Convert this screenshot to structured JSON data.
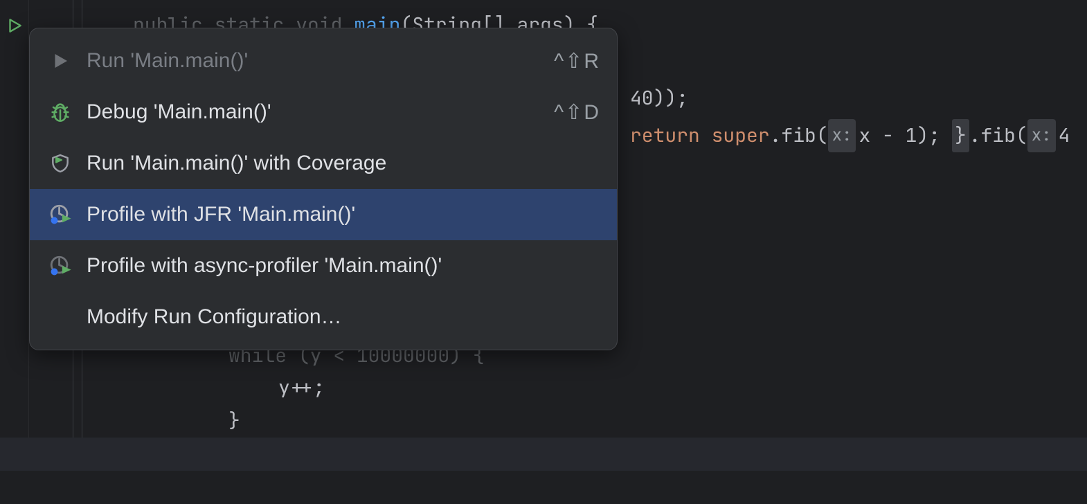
{
  "code": {
    "line1_prefix": "public static void ",
    "line1_method": "main",
    "line1_params": "(String[] args) {",
    "line2_suffix": "40));",
    "line3_kw_return": "return ",
    "line3_kw_super": "super",
    "line3_a": ".fib(",
    "line3_hint1": "x:",
    "line3_b": "x - 1); ",
    "line3_c": "}",
    "line3_d": ".fib(",
    "line3_hint2": "x:",
    "line3_e": "4",
    "line4_a": "while (",
    "line4_b": "y",
    "line4_c": " < ",
    "line4_d": "10000000",
    "line4_e": ") {",
    "line5": "y++;",
    "line6": "}"
  },
  "menu": {
    "run_label": "Run 'Main.main()'",
    "run_shortcut": "^⇧R",
    "debug_label": "Debug 'Main.main()'",
    "debug_shortcut": "^⇧D",
    "coverage_label": "Run 'Main.main()' with Coverage",
    "jfr_label": "Profile with JFR 'Main.main()'",
    "async_label": "Profile with async-profiler 'Main.main()'",
    "modify_label": "Modify Run Configuration…"
  }
}
